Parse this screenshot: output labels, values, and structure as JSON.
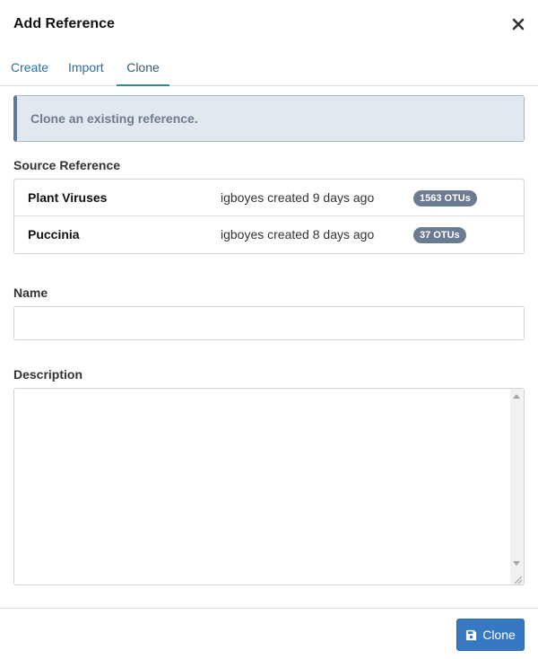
{
  "modal": {
    "title": "Add Reference",
    "close_icon": "close-icon"
  },
  "tabs": [
    {
      "label": "Create",
      "active": false
    },
    {
      "label": "Import",
      "active": false
    },
    {
      "label": "Clone",
      "active": true
    }
  ],
  "alert": {
    "text": "Clone an existing reference."
  },
  "source_reference": {
    "label": "Source Reference",
    "items": [
      {
        "name": "Plant Viruses",
        "meta": "igboyes created 9 days ago",
        "badge": "1563 OTUs"
      },
      {
        "name": "Puccinia",
        "meta": "igboyes created 8 days ago",
        "badge": "37 OTUs"
      }
    ]
  },
  "name_field": {
    "label": "Name",
    "value": "",
    "placeholder": ""
  },
  "description_field": {
    "label": "Description",
    "value": "",
    "placeholder": ""
  },
  "footer": {
    "submit_label": "Clone",
    "submit_icon": "save-icon"
  },
  "colors": {
    "primary": "#3778c2",
    "tab_active_border": "#3c8786",
    "link": "#2d6ea1",
    "alert_bg": "#e2e8f0",
    "badge_bg": "#6b7c92"
  }
}
